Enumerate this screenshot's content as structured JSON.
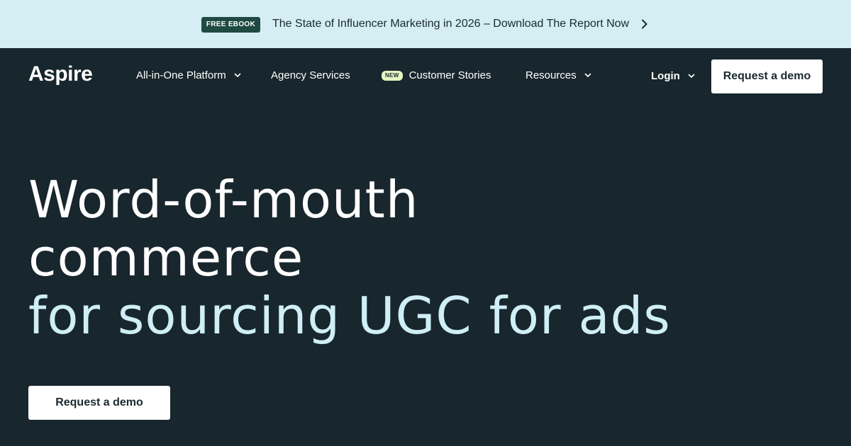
{
  "banner": {
    "badge": "FREE EBOOK",
    "text": "The State of Influencer Marketing in 2026 – Download The Report Now",
    "chevron_icon": "chevron-right-icon",
    "background": "#d4eef4",
    "badge_color": "#1f4a44"
  },
  "nav": {
    "logo": "Aspire",
    "items": [
      {
        "label": "All-in-One Platform",
        "icon": "chevron-down-icon"
      },
      {
        "label": "Agency Services"
      },
      {
        "label": "Customer Stories",
        "badge": "NEW"
      },
      {
        "label": "Resources",
        "icon": "chevron-down-icon"
      }
    ],
    "login": "Login",
    "cta": "Request a demo"
  },
  "hero": {
    "line1": "Word-of-mouth",
    "line2": "commerce",
    "line3": "for sourcing UGC for ads",
    "cta": "Request a demo",
    "accent_color": "#cfeef6",
    "background": "#18262d"
  }
}
